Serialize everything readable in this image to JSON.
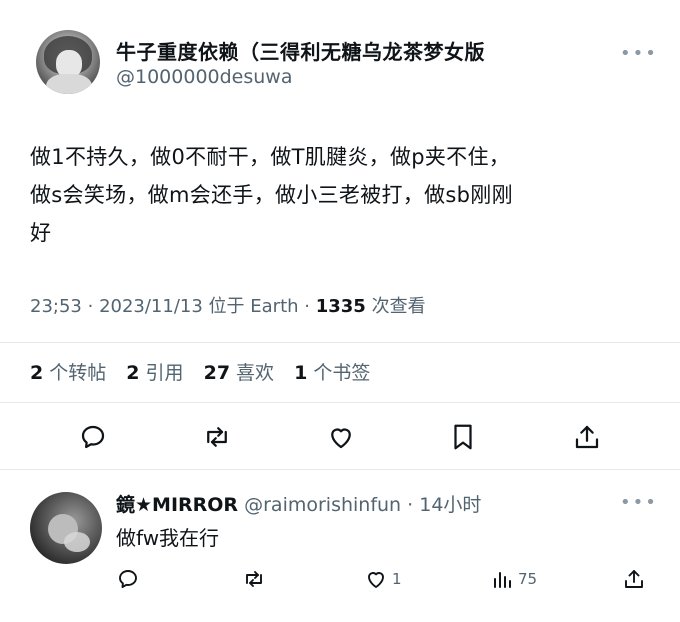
{
  "post": {
    "display_name": "牛子重度依赖（三得利无糖乌龙茶梦女版",
    "handle": "@1000000desuwa",
    "more_icon": "more-horizontal-icon",
    "text_lines": [
      "做1不持久，做0不耐干，做T肌腱炎，做p夹不住，",
      "做s会笑场，做m会还手，做小三老被打，做sb刚刚",
      "好"
    ],
    "meta": {
      "time": "23;53",
      "date": "2023/11/13",
      "location": "位于 Earth",
      "views": "1335",
      "views_label": "次查看"
    },
    "stats": {
      "reposts_count": "2",
      "reposts_label": "个转帖",
      "quotes_count": "2",
      "quotes_label": "引用",
      "likes_count": "27",
      "likes_label": "喜欢",
      "bookmarks_count": "1",
      "bookmarks_label": "个书签"
    },
    "actions": [
      "reply-icon",
      "repost-icon",
      "like-icon",
      "bookmark-icon",
      "share-icon"
    ]
  },
  "reply": {
    "display_name": "鏡★MIRROR",
    "handle": "@raimorishinfun",
    "time": "14小时",
    "text": "做fw我在行",
    "likes_count": "1",
    "views_count": "75",
    "actions": [
      "reply-icon",
      "repost-icon",
      "like-icon",
      "views-icon",
      "share-icon"
    ]
  },
  "colors": {
    "text": "#0f1419",
    "secondary": "#536471",
    "divider": "#e6e9ea"
  }
}
